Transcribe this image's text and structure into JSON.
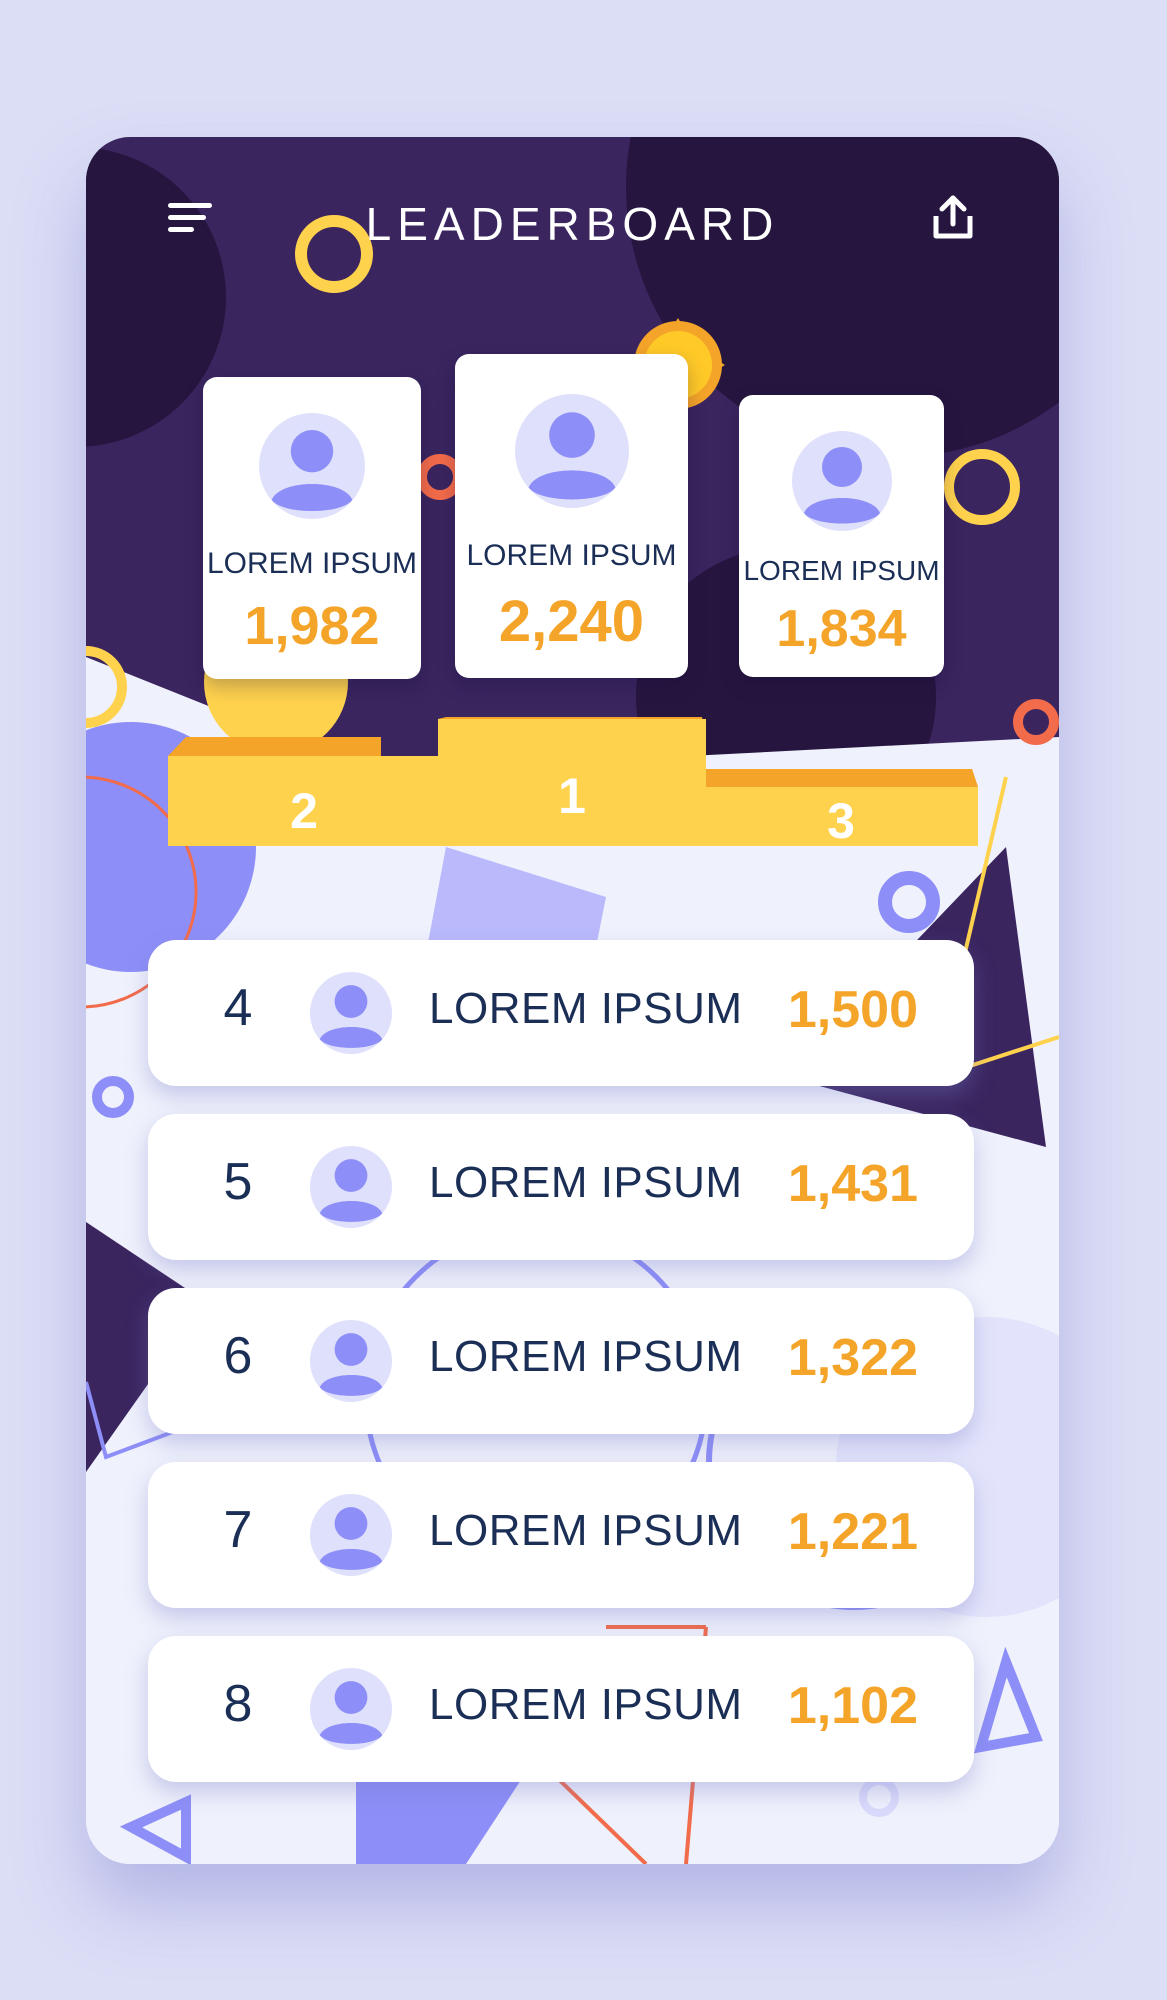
{
  "header": {
    "title": "LEADERBOARD",
    "menu_icon": "menu-icon",
    "share_icon": "share-icon"
  },
  "podium": [
    {
      "place": "2",
      "name": "LOREM IPSUM",
      "score": "1,982"
    },
    {
      "place": "1",
      "name": "LOREM IPSUM",
      "score": "2,240"
    },
    {
      "place": "3",
      "name": "LOREM IPSUM",
      "score": "1,834"
    }
  ],
  "rows": [
    {
      "rank": "4",
      "name": "LOREM IPSUM",
      "score": "1,500"
    },
    {
      "rank": "5",
      "name": "LOREM IPSUM",
      "score": "1,431"
    },
    {
      "rank": "6",
      "name": "LOREM IPSUM",
      "score": "1,322"
    },
    {
      "rank": "7",
      "name": "LOREM IPSUM",
      "score": "1,221"
    },
    {
      "rank": "8",
      "name": "LOREM IPSUM",
      "score": "1,102"
    }
  ],
  "colors": {
    "header_dark": "#2a1a4a",
    "header_purple": "#3a255f",
    "accent_yellow": "#ffd24d",
    "accent_orange": "#f4a428",
    "avatar": "#8d8ef7",
    "avatar_bg": "#dfe0fb",
    "text_navy": "#1b2f56"
  }
}
